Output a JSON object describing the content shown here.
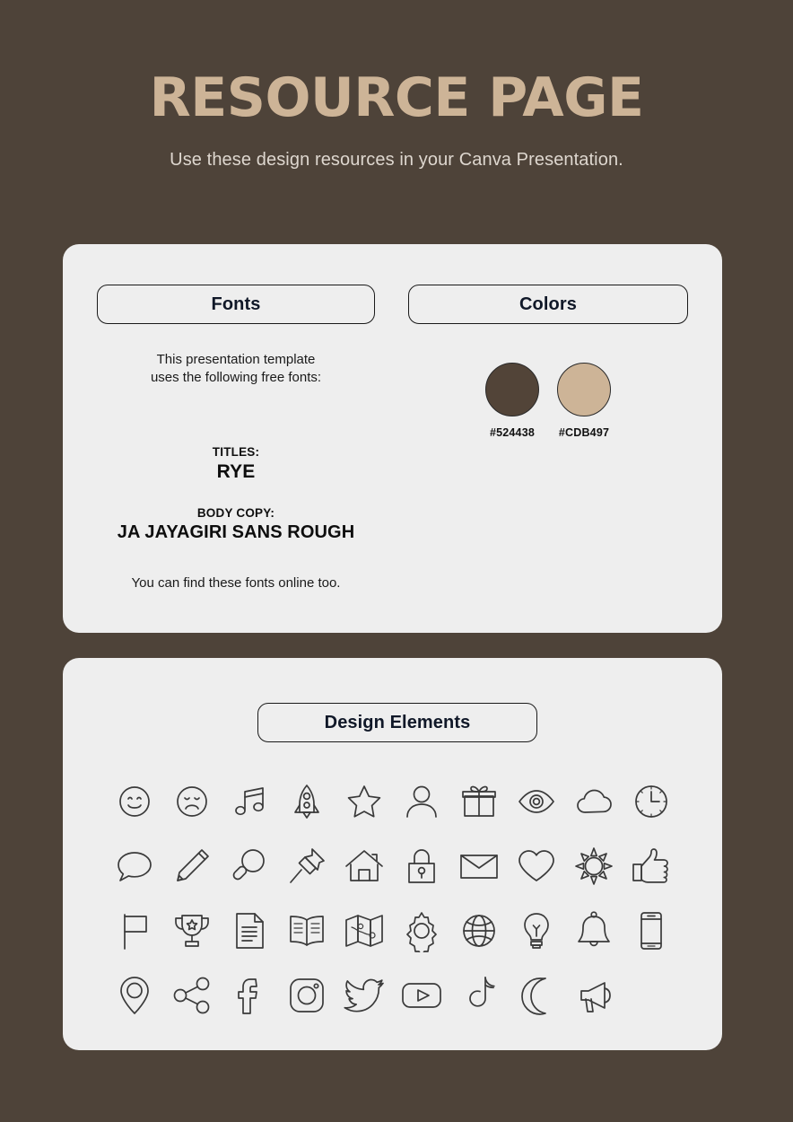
{
  "header": {
    "title": "RESOURCE PAGE",
    "subtitle": "Use these design resources in your Canva Presentation."
  },
  "fonts_section": {
    "heading": "Fonts",
    "intro_line1": "This presentation template",
    "intro_line2": "uses the following free fonts:",
    "titles_role": "TITLES:",
    "titles_font": "RYE",
    "body_role": "BODY COPY:",
    "body_font": "JA JAYAGIRI SANS ROUGH",
    "outro": "You can find these fonts online too."
  },
  "colors_section": {
    "heading": "Colors",
    "swatches": [
      {
        "hex": "#524438",
        "label": "#524438"
      },
      {
        "hex": "#CDB497",
        "label": "#CDB497"
      }
    ]
  },
  "design_elements": {
    "heading": "Design Elements",
    "icons": [
      "smiley-face-icon",
      "sad-face-icon",
      "music-note-icon",
      "rocket-icon",
      "star-icon",
      "person-icon",
      "gift-icon",
      "eye-icon",
      "cloud-icon",
      "clock-icon",
      "speech-bubble-icon",
      "pencil-icon",
      "magnifying-glass-icon",
      "pushpin-icon",
      "house-icon",
      "lock-icon",
      "envelope-icon",
      "heart-icon",
      "sun-icon",
      "thumbs-up-icon",
      "flag-icon",
      "trophy-icon",
      "document-icon",
      "open-book-icon",
      "map-icon",
      "gear-icon",
      "globe-icon",
      "lightbulb-icon",
      "bell-icon",
      "smartphone-icon",
      "location-pin-icon",
      "share-icon",
      "facebook-icon",
      "instagram-icon",
      "twitter-icon",
      "youtube-icon",
      "tiktok-icon",
      "moon-icon",
      "megaphone-icon"
    ]
  },
  "theme": {
    "background": "#4E4339",
    "title_color": "#CDB497",
    "card_background": "#EEEEEE"
  }
}
